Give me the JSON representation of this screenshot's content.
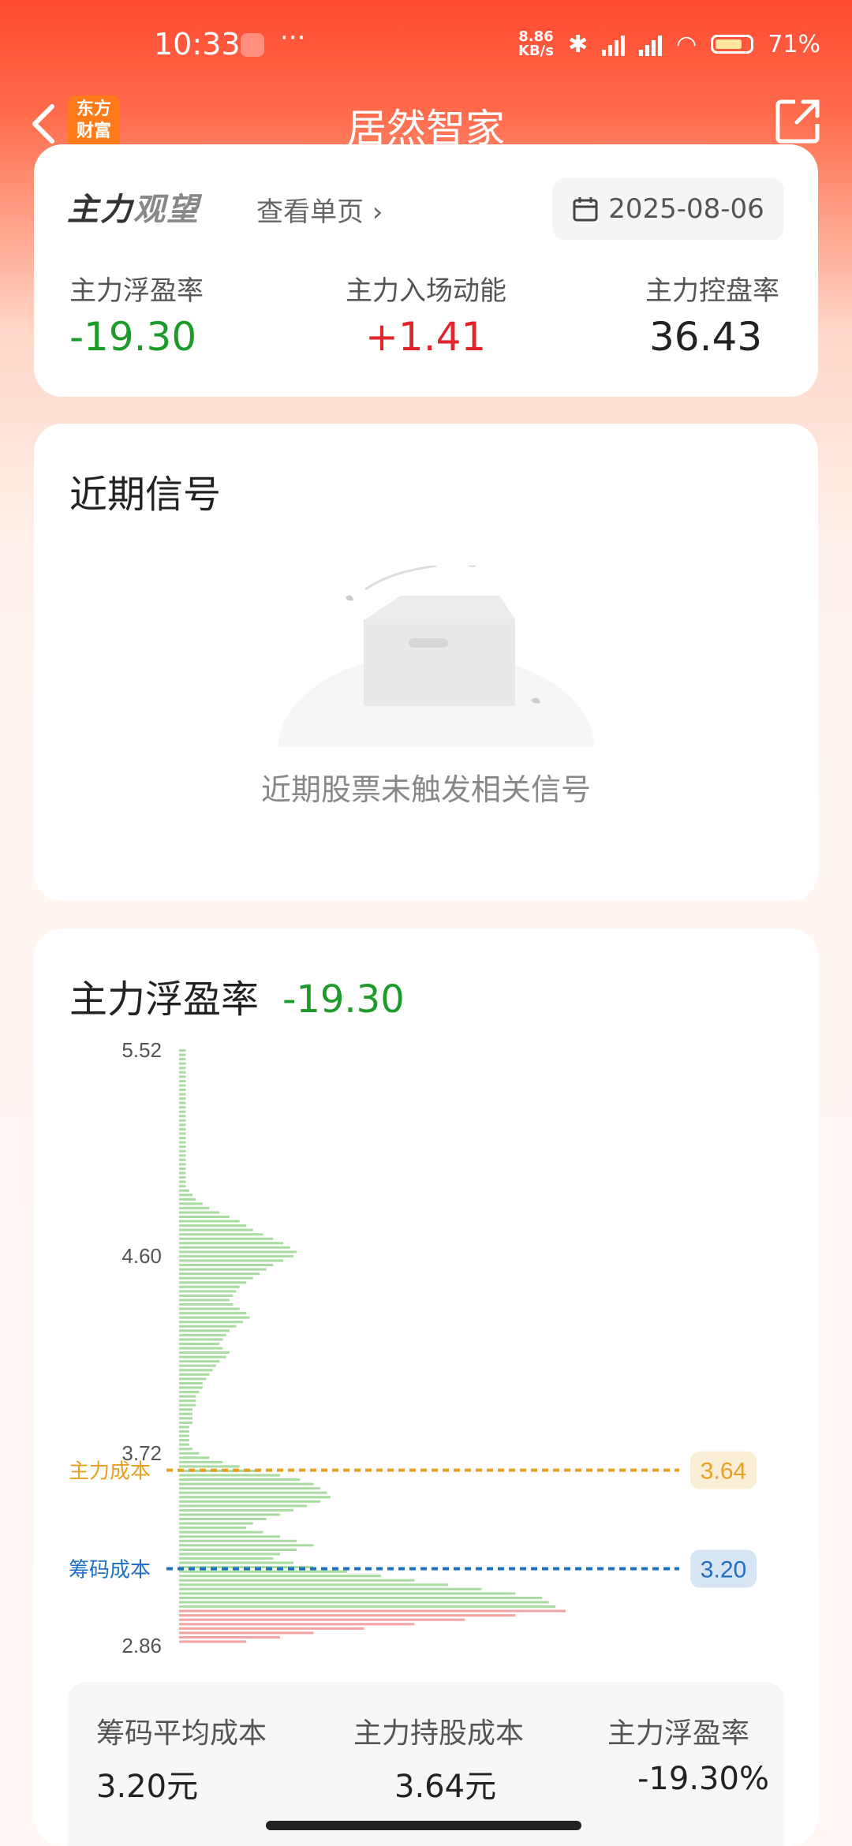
{
  "status": {
    "time": "10:33",
    "net_speed_top": "8.86",
    "net_speed_unit": "KB/s",
    "sim1": "HD",
    "sim2": "HD",
    "battery": "71%",
    "battery_level": 0.71
  },
  "header": {
    "back_icon": "chevron-left-icon",
    "logo_line1": "东方",
    "logo_line2": "财富",
    "title": "居然智家",
    "share_icon": "share-icon"
  },
  "summary_card": {
    "brand_a": "主力",
    "brand_b": "观望",
    "view_link": "查看单页",
    "date": "2025-08-06",
    "metrics": [
      {
        "label": "主力浮盈率",
        "value": "-19.30",
        "color": "#1d9b2a"
      },
      {
        "label": "主力入场动能",
        "value": "+1.41",
        "color": "#e0262a"
      },
      {
        "label": "主力控盘率",
        "value": "36.43",
        "color": "#222222"
      }
    ]
  },
  "signals": {
    "title": "近期信号",
    "empty_text": "近期股票未触发相关信号"
  },
  "profit": {
    "title": "主力浮盈率",
    "value": "-19.30",
    "summary": [
      {
        "label": "筹码平均成本",
        "value": "3.20元"
      },
      {
        "label": "主力持股成本",
        "value": "3.64元"
      },
      {
        "label": "主力浮盈率",
        "value": "-19.30%"
      }
    ]
  },
  "chart_data": {
    "type": "bar",
    "orientation": "horizontal",
    "title": "",
    "y_tick_labels": [
      "5.52",
      "4.60",
      "3.72",
      "2.86"
    ],
    "ylim": [
      2.86,
      5.52
    ],
    "reference_lines": [
      {
        "label": "主力成本",
        "value": 3.64,
        "value_label": "3.64",
        "color": "#e8a020"
      },
      {
        "label": "筹码成本",
        "value": 3.2,
        "value_label": "3.20",
        "color": "#1f6fc4"
      }
    ],
    "colors": {
      "above_price": "#a8dca0",
      "below_price": "#f3a3a3"
    },
    "price_levels_top_to_bottom_step": 0.0105,
    "values": [
      2,
      2,
      2,
      2,
      2,
      2,
      2,
      2,
      2,
      2,
      2,
      2,
      2,
      2,
      2,
      2,
      2,
      2,
      2,
      2,
      2,
      2,
      2,
      2,
      2,
      2,
      2,
      2,
      2,
      2,
      2,
      2,
      3,
      4,
      5,
      7,
      9,
      12,
      15,
      18,
      20,
      22,
      25,
      28,
      31,
      33,
      35,
      34,
      31,
      28,
      26,
      24,
      22,
      20,
      18,
      17,
      16,
      15,
      16,
      18,
      20,
      21,
      19,
      17,
      15,
      14,
      13,
      12,
      13,
      15,
      14,
      12,
      11,
      10,
      9,
      8,
      7,
      7,
      6,
      5,
      5,
      5,
      4,
      4,
      4,
      4,
      3,
      3,
      3,
      3,
      3,
      4,
      6,
      9,
      13,
      18,
      24,
      30,
      36,
      40,
      42,
      44,
      45,
      42,
      38,
      34,
      30,
      26,
      22,
      20,
      25,
      30,
      35,
      40,
      35,
      30,
      28,
      34,
      40,
      50,
      60,
      70,
      80,
      90,
      100,
      108,
      110,
      112,
      115,
      100,
      85,
      70,
      55,
      40,
      30,
      20
    ],
    "red_from_index": 128
  }
}
